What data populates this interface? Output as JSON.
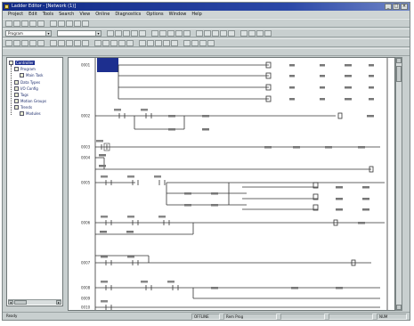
{
  "window": {
    "title": "Ladder Editor - [Network (1)]",
    "controls": [
      "_",
      "□",
      "×"
    ]
  },
  "menu": [
    "Project",
    "Edit",
    "Tools",
    "Search",
    "View",
    "Online",
    "Diagnostics",
    "Options",
    "Window",
    "Help"
  ],
  "toolbar1": {
    "buttons": [
      "new",
      "open",
      "save",
      "print",
      "cut",
      "copy",
      "paste",
      "undo",
      "find",
      "zoom"
    ]
  },
  "toolbar2": {
    "select_a": "Program",
    "select_b": "",
    "buttons": [
      "b1",
      "b2",
      "b3",
      "b4",
      "b5",
      "b6",
      "b7",
      "b8",
      "b9",
      "b10",
      "b11",
      "b12",
      "b13",
      "b14",
      "b15",
      "b16",
      "b17",
      "b18",
      "b19"
    ]
  },
  "toolbar3": {
    "buttons": [
      "c1",
      "c2",
      "c3",
      "c4",
      "c5",
      "c6",
      "c7",
      "c8",
      "c9",
      "c10",
      "c11",
      "c12",
      "c13",
      "c14",
      "c15",
      "c16",
      "c17",
      "c18",
      "c19",
      "c20",
      "c21",
      "c22",
      "c23",
      "c24"
    ]
  },
  "tree": {
    "items": [
      {
        "label": "Controller",
        "selected": true
      },
      {
        "label": "Program"
      },
      {
        "label": "Main Task"
      },
      {
        "label": "Data Types"
      },
      {
        "label": "I/O Config"
      },
      {
        "label": "Tags"
      },
      {
        "label": "Motion Groups"
      },
      {
        "label": "Trends"
      },
      {
        "label": "Modules"
      }
    ]
  },
  "status": {
    "left": "Ready",
    "offline": "OFFLINE",
    "mode": "Rem Prog",
    "num": "NUM"
  },
  "ladder": {
    "rungs": [
      "0001",
      "0002",
      "0003",
      "0004",
      "0005",
      "0006",
      "0007",
      "0008",
      "0009",
      "0010"
    ]
  }
}
